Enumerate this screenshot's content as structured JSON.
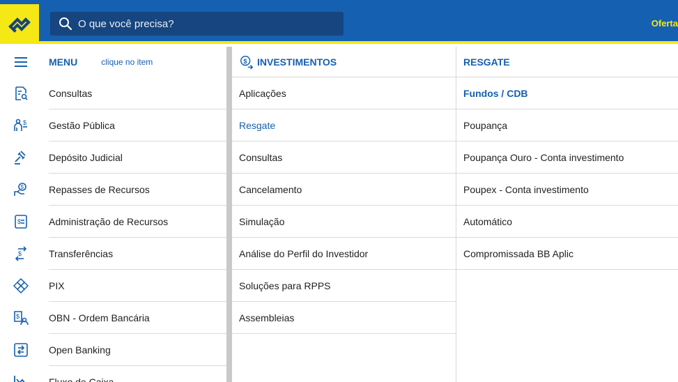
{
  "header": {
    "search_placeholder": "O que você precisa?",
    "offers_label": "Oferta"
  },
  "menu": {
    "title": "MENU",
    "hint": "clique no item",
    "items": [
      {
        "label": "Consultas",
        "icon": "document-search-icon"
      },
      {
        "label": "Gestão Pública",
        "icon": "people-money-icon"
      },
      {
        "label": "Depósito Judicial",
        "icon": "gavel-icon"
      },
      {
        "label": "Repasses de Recursos",
        "icon": "hand-coin-icon"
      },
      {
        "label": "Administração de Recursos",
        "icon": "money-document-icon"
      },
      {
        "label": "Transferências",
        "icon": "transfer-arrows-icon"
      },
      {
        "label": "PIX",
        "icon": "pix-icon"
      },
      {
        "label": "OBN - Ordem Bancária",
        "icon": "bank-order-icon"
      },
      {
        "label": "Open Banking",
        "icon": "open-banking-icon"
      },
      {
        "label": "Fluxo de Caixa",
        "icon": "chart-line-icon"
      }
    ]
  },
  "investments": {
    "title": "INVESTIMENTOS",
    "items": [
      {
        "label": "Aplicações"
      },
      {
        "label": "Resgate",
        "active": true
      },
      {
        "label": "Consultas"
      },
      {
        "label": "Cancelamento"
      },
      {
        "label": "Simulação"
      },
      {
        "label": "Análise do Perfil do Investidor"
      },
      {
        "label": "Soluções para RPPS"
      },
      {
        "label": "Assembleias"
      }
    ]
  },
  "resgate": {
    "title": "RESGATE",
    "items": [
      {
        "label": "Fundos / CDB",
        "active": true
      },
      {
        "label": "Poupança"
      },
      {
        "label": "Poupança Ouro - Conta investimento"
      },
      {
        "label": "Poupex - Conta investimento"
      },
      {
        "label": "Automático"
      },
      {
        "label": "Compromissada BB Aplic"
      }
    ]
  },
  "colors": {
    "brand_blue": "#1560b0",
    "brand_yellow": "#f5e814",
    "search_bg": "#16457f"
  }
}
